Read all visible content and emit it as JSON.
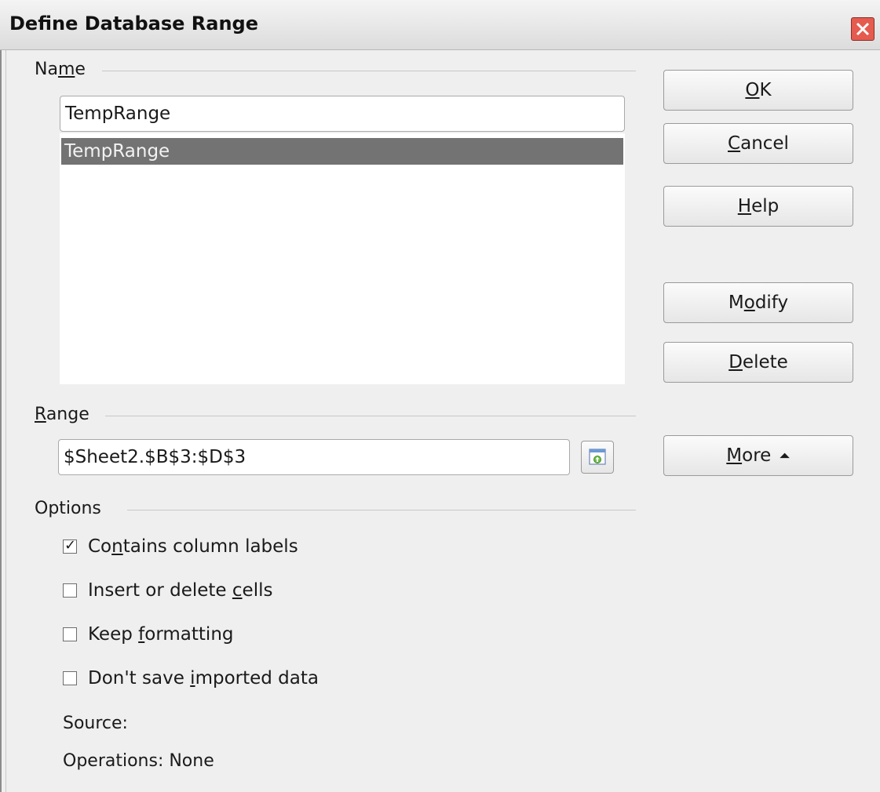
{
  "window": {
    "title": "Define Database Range",
    "close_icon": "close-icon"
  },
  "name_group": {
    "label_pre": "Na",
    "label_mnemonic": "m",
    "label_post": "e",
    "input_value": "TempRange",
    "list_items": [
      "TempRange"
    ]
  },
  "buttons": {
    "ok": {
      "pre": "",
      "mnemonic": "O",
      "post": "K"
    },
    "cancel": {
      "pre": "",
      "mnemonic": "C",
      "post": "ancel"
    },
    "help": {
      "pre": "",
      "mnemonic": "H",
      "post": "elp"
    },
    "modify": {
      "pre": "M",
      "mnemonic": "o",
      "post": "dify"
    },
    "delete": {
      "pre": "",
      "mnemonic": "D",
      "post": "elete"
    },
    "more": {
      "pre": "",
      "mnemonic": "M",
      "post": "ore",
      "arrow": "⏶"
    }
  },
  "range_group": {
    "label_pre": "",
    "label_mnemonic": "R",
    "label_post": "ange",
    "input_value": "$Sheet2.$B$3:$D$3",
    "shrink_icon": "shrink-dialog-icon"
  },
  "options_group": {
    "label": "Options",
    "checkboxes": [
      {
        "pre": "Co",
        "mnemonic": "n",
        "post": "tains column labels",
        "checked": true
      },
      {
        "pre": "Insert or delete ",
        "mnemonic": "c",
        "post": "ells",
        "checked": false
      },
      {
        "pre": "Keep ",
        "mnemonic": "f",
        "post": "ormatting",
        "checked": false
      },
      {
        "pre": "Don't save ",
        "mnemonic": "i",
        "post": "mported data",
        "checked": false
      }
    ],
    "check_glyph": "✓"
  },
  "info": {
    "source": "Source:",
    "operations": "Operations: None"
  },
  "colors": {
    "selection": "#737373",
    "close": "#e55b4f",
    "background": "#efefef"
  }
}
